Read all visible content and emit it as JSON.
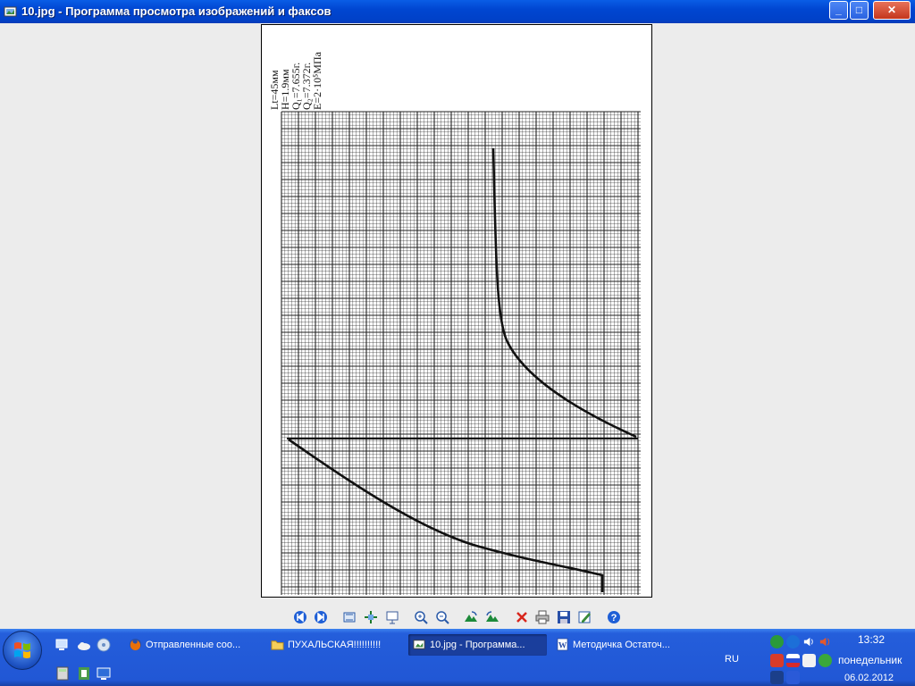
{
  "window": {
    "title": "10.jpg - Программа просмотра изображений и факсов",
    "minimize_glyph": "_",
    "maximize_glyph": "□",
    "close_glyph": "✕"
  },
  "image_content": {
    "legend": [
      "Lt=45мм",
      "H=1.9мм",
      "Q₁=7.655г.",
      "Q₂=7.372г.",
      "E=2·10⁵МПа"
    ]
  },
  "toolbar": {
    "icons": [
      "previous-image-icon",
      "next-image-icon",
      "best-fit-icon",
      "actual-size-icon",
      "slideshow-icon",
      "zoom-in-icon",
      "zoom-out-icon",
      "rotate-clockwise-icon",
      "rotate-counterclockwise-icon",
      "delete-icon",
      "print-icon",
      "save-icon",
      "edit-icon",
      "help-icon"
    ]
  },
  "taskbar": {
    "buttons": [
      {
        "label": "Отправленные соо...",
        "icon": "firefox-icon"
      },
      {
        "label": "ПУХАЛЬСКАЯ!!!!!!!!!!",
        "icon": "folder-icon"
      },
      {
        "label": "10.jpg - Программа...",
        "icon": "image-viewer-icon"
      },
      {
        "label": "Методичка Остаточ...",
        "icon": "word-document-icon"
      }
    ],
    "language": "RU",
    "clock": {
      "time": "13:32",
      "day": "понедельник",
      "date": "06.02.2012"
    }
  },
  "colors": {
    "titlebar": "#0046d1",
    "taskbar": "#245edb",
    "chart_line": "#111111",
    "paper": "#ffffff"
  }
}
